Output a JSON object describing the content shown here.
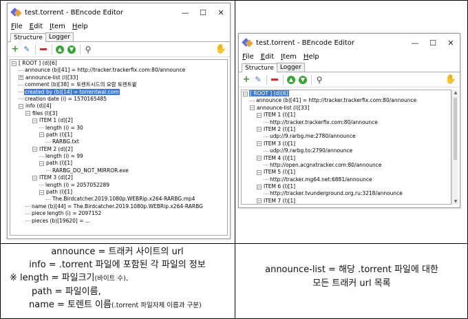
{
  "left_window": {
    "title": "test.torrent - BEncode Editor",
    "menu": [
      {
        "key": "F",
        "rest": "ile"
      },
      {
        "key": "E",
        "rest": "dit"
      },
      {
        "key": "I",
        "rest": "tem"
      },
      {
        "key": "H",
        "rest": "elp"
      }
    ],
    "tabs": [
      "Structure",
      "Logger"
    ],
    "tree": [
      {
        "indent": 0,
        "exp": "-",
        "text": "[ ROOT ] (d)[6]",
        "selected": false
      },
      {
        "indent": 1,
        "exp": "",
        "text": "announce (b)[41] = http://tracker.trackerfix.com:80/announce",
        "selected": false
      },
      {
        "indent": 1,
        "exp": "+",
        "text": "announce-list (l)[33]",
        "selected": false
      },
      {
        "indent": 1,
        "exp": "",
        "text": "comment (b)[38] = 토렌트시드의 요람 토렌트왈",
        "selected": false
      },
      {
        "indent": 1,
        "exp": "",
        "text": "created by (b)[14] = torrentwal.com",
        "selected": true
      },
      {
        "indent": 1,
        "exp": "",
        "text": "creation date (i) = 1570165485",
        "selected": false
      },
      {
        "indent": 1,
        "exp": "-",
        "text": "info (d)[4]",
        "selected": false
      },
      {
        "indent": 2,
        "exp": "-",
        "text": "files (l)[3]",
        "selected": false
      },
      {
        "indent": 3,
        "exp": "-",
        "text": "ITEM 1 (d)[2]",
        "selected": false
      },
      {
        "indent": 4,
        "exp": "",
        "text": "length (i) = 30",
        "selected": false
      },
      {
        "indent": 4,
        "exp": "-",
        "text": "path (l)[1]",
        "selected": false
      },
      {
        "indent": 5,
        "exp": "",
        "text": "RARBG.txt",
        "selected": false
      },
      {
        "indent": 3,
        "exp": "-",
        "text": "ITEM 2 (d)[2]",
        "selected": false
      },
      {
        "indent": 4,
        "exp": "",
        "text": "length (i) = 99",
        "selected": false
      },
      {
        "indent": 4,
        "exp": "-",
        "text": "path (l)[1]",
        "selected": false
      },
      {
        "indent": 5,
        "exp": "",
        "text": "RARBG_DO_NOT_MIRROR.exe",
        "selected": false
      },
      {
        "indent": 3,
        "exp": "-",
        "text": "ITEM 3 (d)[2]",
        "selected": false
      },
      {
        "indent": 4,
        "exp": "",
        "text": "length (i) = 2057052289",
        "selected": false
      },
      {
        "indent": 4,
        "exp": "-",
        "text": "path (l)[1]",
        "selected": false
      },
      {
        "indent": 5,
        "exp": "",
        "text": "The.Birdcatcher.2019.1080p.WEBRip.x264-RARBG.mp4",
        "selected": false
      },
      {
        "indent": 2,
        "exp": "",
        "text": "name (b)[44] = The.Birdcatcher.2019.1080p.WEBRip.x264-RARBG",
        "selected": false
      },
      {
        "indent": 2,
        "exp": "",
        "text": "piece length (i) = 2097152",
        "selected": false
      },
      {
        "indent": 2,
        "exp": "",
        "text": "pieces (b)[19620] = ...",
        "selected": false
      }
    ]
  },
  "right_window": {
    "title": "test.torrent - BEncode Editor",
    "menu": [
      {
        "key": "F",
        "rest": "ile"
      },
      {
        "key": "E",
        "rest": "dit"
      },
      {
        "key": "I",
        "rest": "tem"
      },
      {
        "key": "H",
        "rest": "elp"
      }
    ],
    "tabs": [
      "Structure",
      "Logger"
    ],
    "tree": [
      {
        "indent": 0,
        "exp": "-",
        "text": "[ ROOT ] (d)[6]",
        "selected": true
      },
      {
        "indent": 1,
        "exp": "",
        "text": "announce (b)[41] = http://tracker.trackerfix.com:80/announce",
        "selected": false
      },
      {
        "indent": 1,
        "exp": "-",
        "text": "announce-list (l)[33]",
        "selected": false
      },
      {
        "indent": 2,
        "exp": "-",
        "text": "ITEM 1 (l)[1]",
        "selected": false
      },
      {
        "indent": 3,
        "exp": "",
        "text": "http://tracker.trackerfix.com:80/announce",
        "selected": false
      },
      {
        "indent": 2,
        "exp": "-",
        "text": "ITEM 2 (l)[1]",
        "selected": false
      },
      {
        "indent": 3,
        "exp": "",
        "text": "udp://9.rarbg.me:2780/announce",
        "selected": false
      },
      {
        "indent": 2,
        "exp": "-",
        "text": "ITEM 3 (l)[1]",
        "selected": false
      },
      {
        "indent": 3,
        "exp": "",
        "text": "udp://9.rarbg.to:2790/announce",
        "selected": false
      },
      {
        "indent": 2,
        "exp": "-",
        "text": "ITEM 4 (l)[1]",
        "selected": false
      },
      {
        "indent": 3,
        "exp": "",
        "text": "http://open.acgnxtracker.com:80/announce",
        "selected": false
      },
      {
        "indent": 2,
        "exp": "-",
        "text": "ITEM 5 (l)[1]",
        "selected": false
      },
      {
        "indent": 3,
        "exp": "",
        "text": "http://tracker.mg64.net:6881/announce",
        "selected": false
      },
      {
        "indent": 2,
        "exp": "-",
        "text": "ITEM 6 (l)[1]",
        "selected": false
      },
      {
        "indent": 3,
        "exp": "",
        "text": "http://tracker.tvunderground.org.ru:3218/announce",
        "selected": false
      },
      {
        "indent": 2,
        "exp": "-",
        "text": "ITEM 7 (l)[1]",
        "selected": false
      }
    ]
  },
  "caption_left": {
    "line1": "announce = 트래커 사이트의 url",
    "line2": "info = .torrent 파일에 포함된 각 파일의 정보",
    "line3_main": "※ length = 파일크기",
    "line3_small": "(바이트 수),",
    "line4": "path = 파일이름,",
    "line5_main": "name = 토렌트 이름",
    "line5_small": "(.torrent 파일자체 이름과 구분)"
  },
  "caption_right": {
    "line1": "announce-list = 해당 .torrent 파일에 대한",
    "line2": "모든 트래커 url 목록"
  },
  "icons": [
    "add-icon",
    "edit-icon",
    "remove-icon",
    "move-up-icon",
    "move-down-icon",
    "search-icon",
    "hand-icon"
  ],
  "colors": {
    "selection": "#3f79d4",
    "add": "#3a9b2c",
    "remove": "#d92b2b",
    "arrows": "#37a437"
  }
}
